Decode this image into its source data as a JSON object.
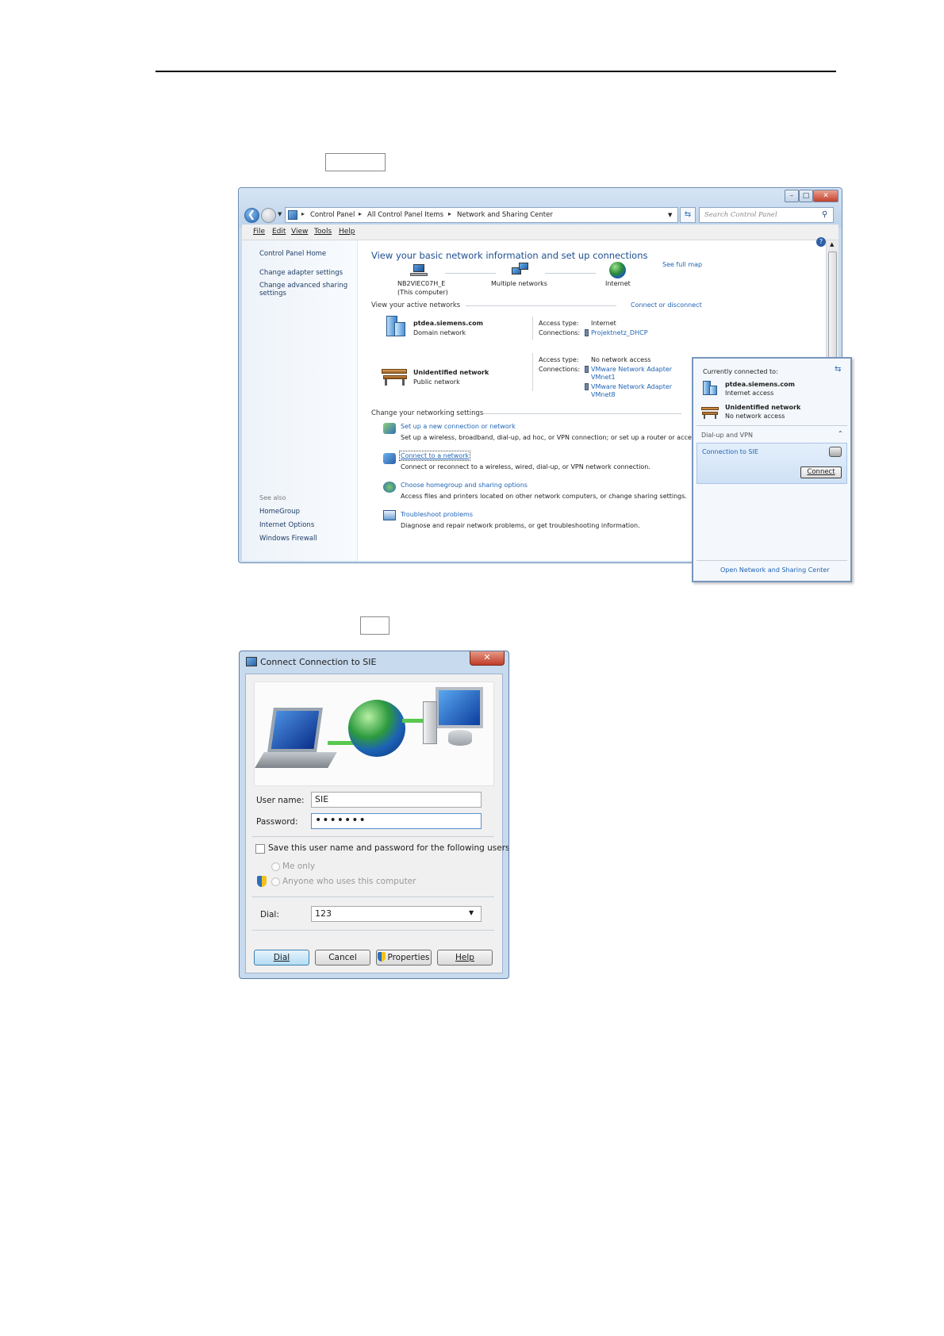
{
  "nsc_window": {
    "breadcrumbs": [
      "Control Panel",
      "All Control Panel Items",
      "Network and Sharing Center"
    ],
    "search_placeholder": "Search Control Panel",
    "menu": [
      "File",
      "Edit",
      "View",
      "Tools",
      "Help"
    ],
    "sidebar": {
      "home": "Control Panel Home",
      "links": [
        "Change adapter settings",
        "Change advanced sharing",
        "settings"
      ],
      "see_also_label": "See also",
      "see_also": [
        "HomeGroup",
        "Internet Options",
        "Windows Firewall"
      ]
    },
    "heading": "View your basic network information and set up connections",
    "see_full_map": "See full map",
    "map": {
      "computer": "NB2VIEC07H_E",
      "computer_sub": "(This computer)",
      "middle": "Multiple networks",
      "internet": "Internet"
    },
    "active_networks_label": "View your active networks",
    "connect_or_disconnect": "Connect or disconnect",
    "networks": [
      {
        "name": "ptdea.siemens.com",
        "category": "Domain network",
        "access_label": "Access type:",
        "access": "Internet",
        "conn_label": "Connections:",
        "connections": [
          "Projektnetz_DHCP"
        ]
      },
      {
        "name": "Unidentified network",
        "category": "Public network",
        "access_label": "Access type:",
        "access": "No network access",
        "conn_label": "Connections:",
        "connections": [
          "VMware Network Adapter",
          "VMnet1",
          "VMware Network Adapter",
          "VMnet8"
        ]
      }
    ],
    "change_settings_label": "Change your networking settings",
    "tasks": [
      {
        "title": "Set up a new connection or network",
        "desc": "Set up a wireless, broadband, dial-up, ad hoc, or VPN connection; or set up a router or access p"
      },
      {
        "title": "Connect to a network",
        "desc": "Connect or reconnect to a wireless, wired, dial-up, or VPN network connection."
      },
      {
        "title": "Choose homegroup and sharing options",
        "desc": "Access files and printers located on other network computers, or change sharing settings."
      },
      {
        "title": "Troubleshoot problems",
        "desc": "Diagnose and repair network problems, or get troubleshooting information."
      }
    ]
  },
  "flyout": {
    "header": "Currently connected to:",
    "networks": [
      {
        "name": "ptdea.siemens.com",
        "status": "Internet access"
      },
      {
        "name": "Unidentified network",
        "status": "No network access"
      }
    ],
    "section": "Dial-up and VPN",
    "connection": "Connection to SIE",
    "connect_button": "Connect",
    "footer_link": "Open Network and Sharing Center"
  },
  "dial_dialog": {
    "title": "Connect Connection to SIE",
    "username_label": "User name:",
    "username_value": "SIE",
    "password_label": "Password:",
    "password_value": "•••••••",
    "save_label": "Save this user name and password for the following users:",
    "option_me": "Me only",
    "option_anyone": "Anyone who uses this computer",
    "dial_label": "Dial:",
    "dial_value": "123",
    "buttons": {
      "dial": "Dial",
      "cancel": "Cancel",
      "properties": "Properties",
      "help": "Help"
    }
  }
}
